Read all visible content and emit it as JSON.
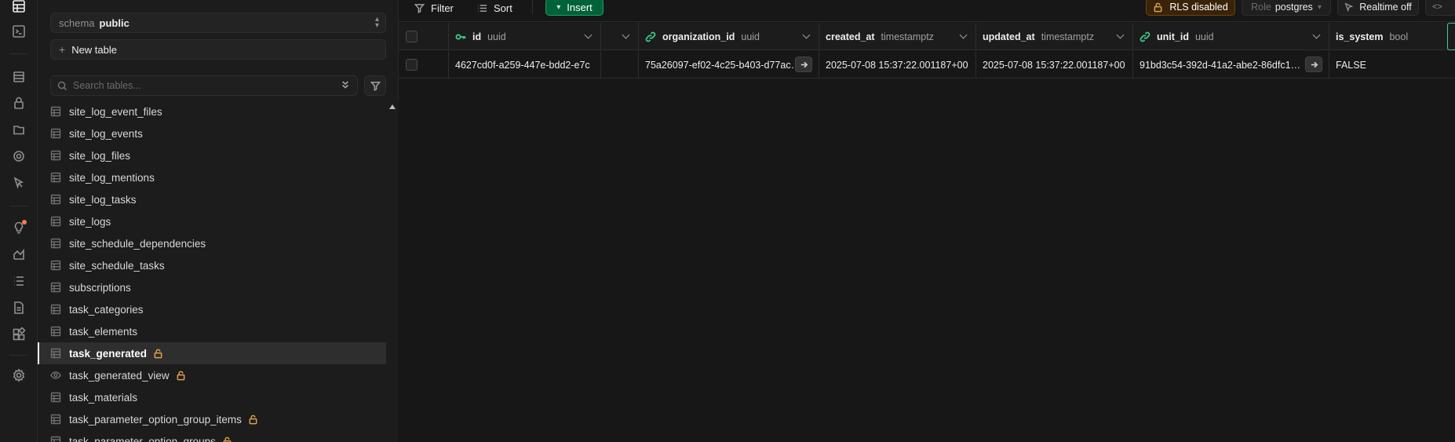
{
  "rail": {
    "icons": [
      "table-editor-icon",
      "sql-editor-icon",
      "database-icon",
      "auth-icon",
      "storage-icon",
      "edge-functions-icon",
      "realtime-icon",
      "advisors-icon",
      "reports-icon",
      "logs-icon",
      "api-docs-icon",
      "integrations-icon",
      "settings-icon"
    ]
  },
  "sidebar": {
    "schema_label": "schema",
    "schema_value": "public",
    "new_table_label": "New table",
    "search_placeholder": "Search tables...",
    "tables": [
      {
        "name": "site_log_event_files",
        "kind": "table",
        "locked": false,
        "active": false
      },
      {
        "name": "site_log_events",
        "kind": "table",
        "locked": false,
        "active": false
      },
      {
        "name": "site_log_files",
        "kind": "table",
        "locked": false,
        "active": false
      },
      {
        "name": "site_log_mentions",
        "kind": "table",
        "locked": false,
        "active": false
      },
      {
        "name": "site_log_tasks",
        "kind": "table",
        "locked": false,
        "active": false
      },
      {
        "name": "site_logs",
        "kind": "table",
        "locked": false,
        "active": false
      },
      {
        "name": "site_schedule_dependencies",
        "kind": "table",
        "locked": false,
        "active": false
      },
      {
        "name": "site_schedule_tasks",
        "kind": "table",
        "locked": false,
        "active": false
      },
      {
        "name": "subscriptions",
        "kind": "table",
        "locked": false,
        "active": false
      },
      {
        "name": "task_categories",
        "kind": "table",
        "locked": false,
        "active": false
      },
      {
        "name": "task_elements",
        "kind": "table",
        "locked": false,
        "active": false
      },
      {
        "name": "task_generated",
        "kind": "table",
        "locked": true,
        "active": true
      },
      {
        "name": "task_generated_view",
        "kind": "view",
        "locked": true,
        "active": false
      },
      {
        "name": "task_materials",
        "kind": "table",
        "locked": false,
        "active": false
      },
      {
        "name": "task_parameter_option_group_items",
        "kind": "table",
        "locked": true,
        "active": false
      },
      {
        "name": "task_parameter_option_groups",
        "kind": "table",
        "locked": true,
        "active": false
      }
    ]
  },
  "toolbar": {
    "filter_label": "Filter",
    "sort_label": "Sort",
    "insert_label": "Insert",
    "rls_label": "RLS disabled",
    "role_label": "Role",
    "role_value": "postgres",
    "realtime_label": "Realtime off",
    "code_label": "<>"
  },
  "grid": {
    "columns": [
      {
        "name": "id",
        "type": "uuid",
        "icon": "key"
      },
      {
        "name": "",
        "type": "",
        "icon": ""
      },
      {
        "name": "organization_id",
        "type": "uuid",
        "icon": "link"
      },
      {
        "name": "created_at",
        "type": "timestamptz",
        "icon": ""
      },
      {
        "name": "updated_at",
        "type": "timestamptz",
        "icon": ""
      },
      {
        "name": "unit_id",
        "type": "uuid",
        "icon": "link"
      },
      {
        "name": "is_system",
        "type": "bool",
        "icon": ""
      }
    ],
    "rows": [
      [
        "4627cd0f-a259-447e-bdd2-e7c",
        "",
        "75a26097-ef02-4c25-b403-d77ac…",
        "2025-07-08 15:37:22.001187+00",
        "2025-07-08 15:37:22.001187+00",
        "91bd3c54-392d-41a2-abe2-86dfc1…",
        "FALSE"
      ]
    ]
  }
}
